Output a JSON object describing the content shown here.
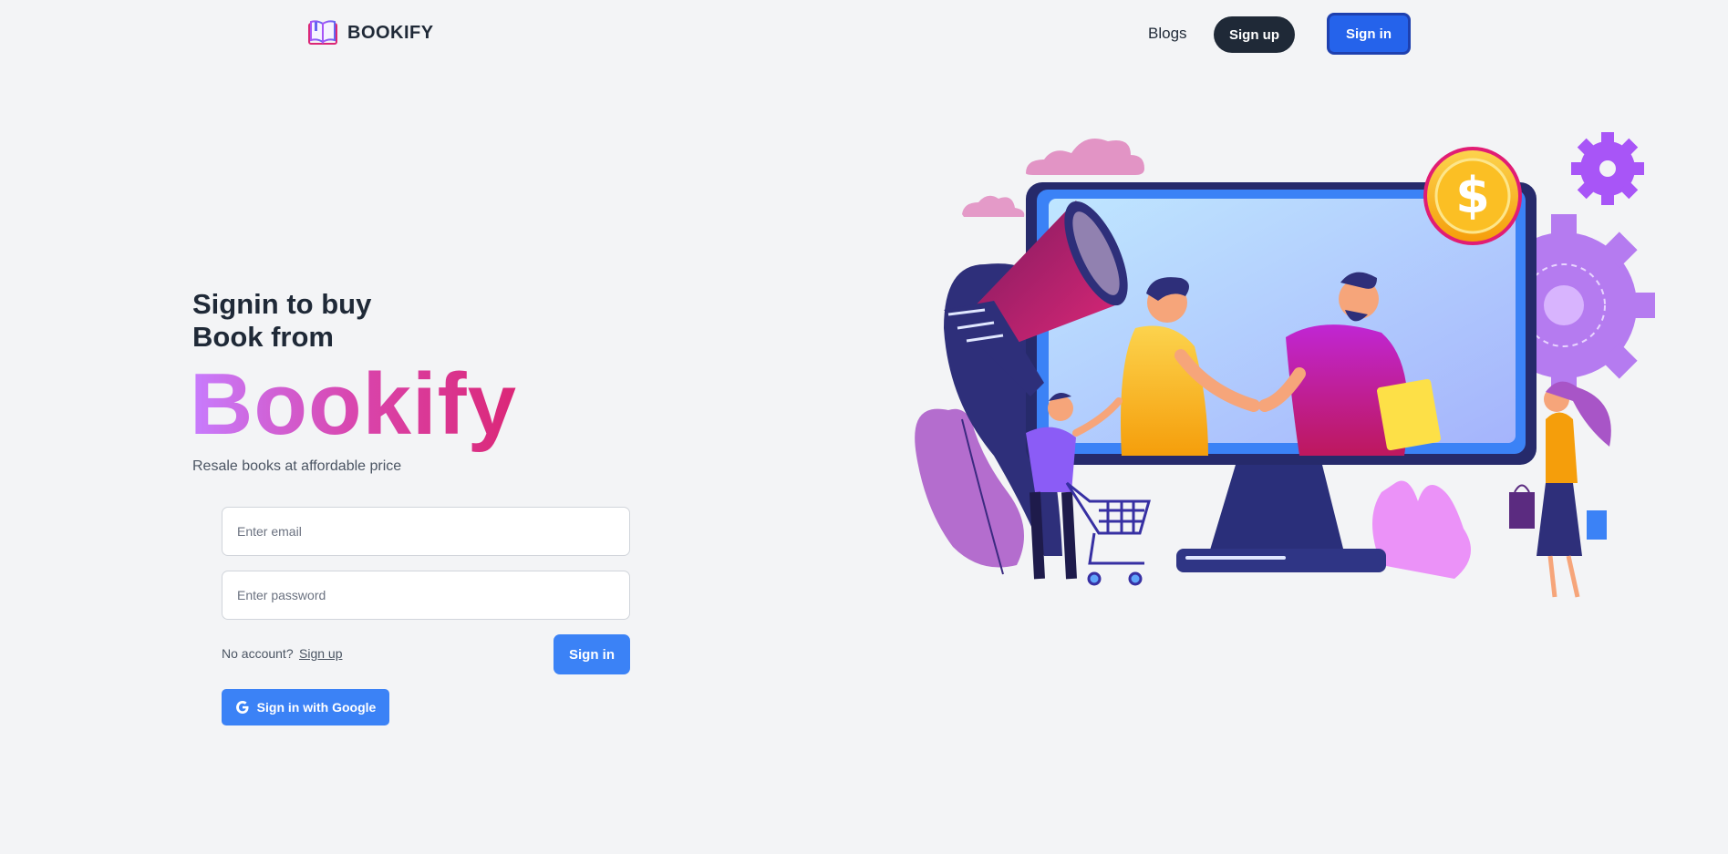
{
  "header": {
    "brand_name": "BOOKIFY",
    "brand_icon": "book-icon",
    "nav": {
      "blogs_label": "Blogs",
      "signup_label": "Sign up",
      "signin_label": "Sign in"
    }
  },
  "hero": {
    "heading_line1": "Signin to buy",
    "heading_line2": "Book from",
    "brand": "Bookify",
    "subtitle": "Resale books at affordable price"
  },
  "form": {
    "email_placeholder": "Enter email",
    "email_value": "",
    "password_placeholder": "Enter password",
    "password_value": "",
    "no_account_text": "No account?",
    "signup_link_label": "Sign up",
    "signin_button_label": "Sign in",
    "google_button_label": "Sign in with Google",
    "google_icon": "google-icon"
  },
  "colors": {
    "background": "#f3f4f6",
    "dark": "#1f2937",
    "primary": "#3b82f6",
    "primary_strong": "#2563eb",
    "brand_gradient_start": "#c77dff",
    "brand_gradient_end": "#db2777"
  },
  "illustration": {
    "icons": [
      "cloud-icon",
      "megaphone-icon",
      "monitor-icon",
      "dollar-coin-icon",
      "gear-icon",
      "shopping-cart-icon",
      "shopping-bag-icon"
    ]
  }
}
